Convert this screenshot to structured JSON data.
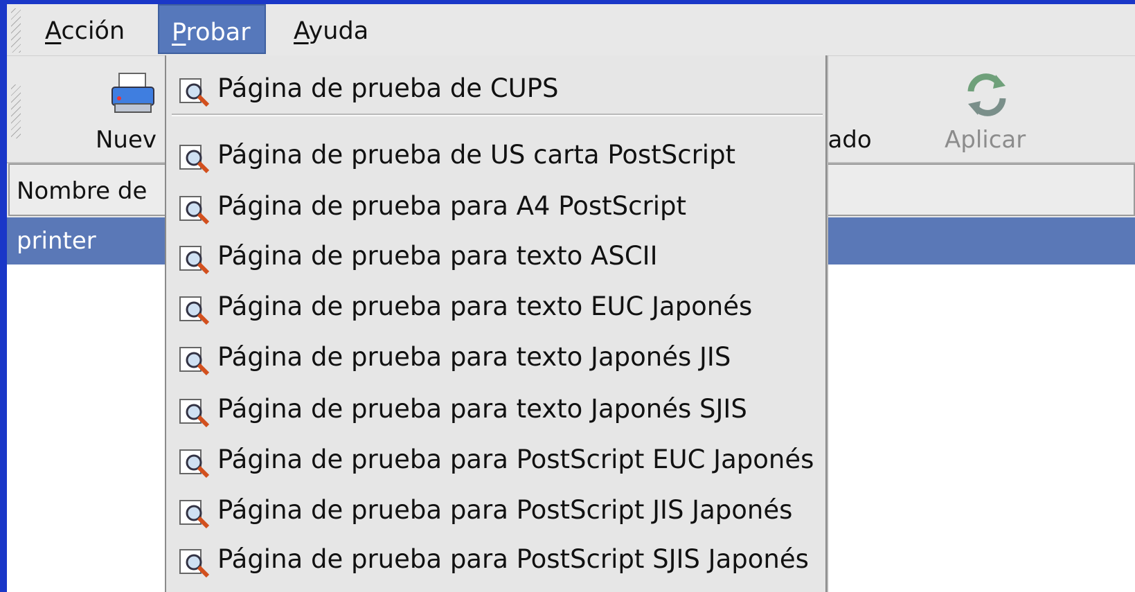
{
  "menubar": {
    "items": [
      {
        "label": "Acción",
        "mnemonic": "A"
      },
      {
        "label": "Probar",
        "mnemonic": "P"
      },
      {
        "label": "Ayuda",
        "mnemonic": "A"
      }
    ]
  },
  "toolbar": {
    "new_label": "Nuev",
    "hidden_label": "iado",
    "apply_label": "Aplicar"
  },
  "list": {
    "header": "Nombre de",
    "selected_row": "printer"
  },
  "dropdown": {
    "items": [
      {
        "label": "Página de prueba de CUPS",
        "icon": "test-page-icon"
      },
      {
        "label": "Página de prueba de US carta PostScript",
        "icon": "test-page-icon"
      },
      {
        "label": "Página de prueba para A4 PostScript",
        "icon": "test-page-icon"
      },
      {
        "label": "Página de prueba para texto ASCII",
        "icon": "test-page-icon"
      },
      {
        "label": "Página de prueba para texto EUC Japonés",
        "icon": "test-page-icon"
      },
      {
        "label": "Página de prueba para texto Japonés JIS",
        "icon": "test-page-icon"
      },
      {
        "label": "Página de prueba para texto Japonés SJIS",
        "icon": "test-page-icon"
      },
      {
        "label": "Página de prueba para PostScript EUC Japonés",
        "icon": "test-page-icon"
      },
      {
        "label": "Página de prueba para PostScript JIS Japonés",
        "icon": "test-page-icon"
      },
      {
        "label": "Página de prueba para PostScript SJIS Japonés",
        "icon": "test-page-icon"
      }
    ]
  },
  "colors": {
    "desktop": "#1a37c8",
    "selection": "#5a78b7",
    "window_bg": "#e8e8e8"
  }
}
